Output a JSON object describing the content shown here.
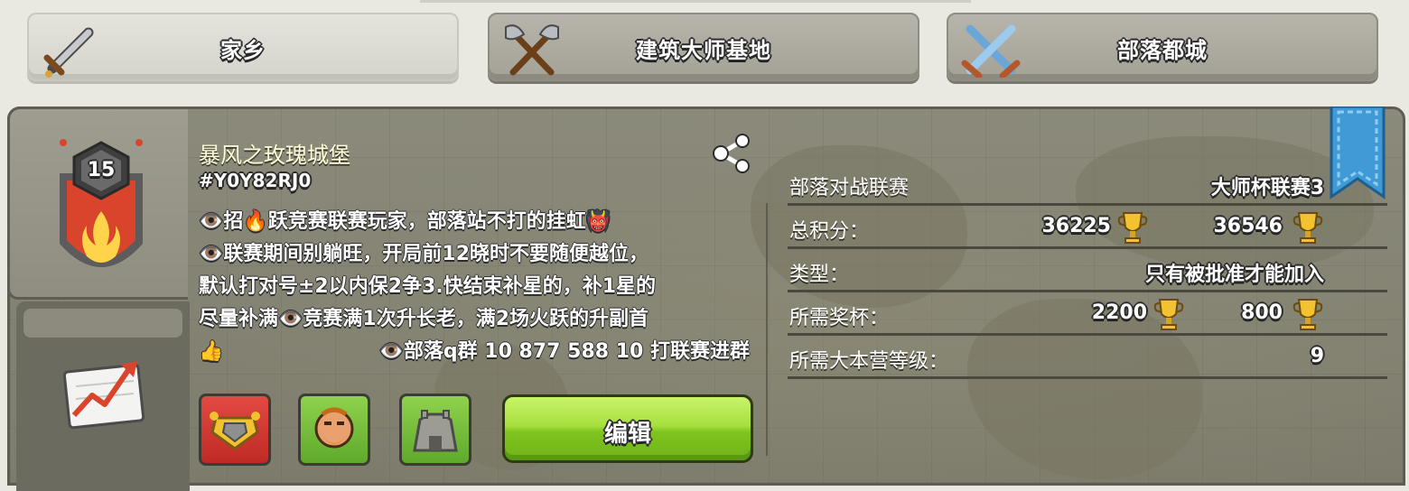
{
  "tabs": [
    {
      "label": "家乡",
      "icon": "sword-icon",
      "active": true
    },
    {
      "label": "建筑大师基地",
      "icon": "crossed-axes-icon",
      "active": false
    },
    {
      "label": "部落都城",
      "icon": "crossed-swords-icon",
      "active": false
    }
  ],
  "clan": {
    "level": "15",
    "name": "暴风之玫瑰城堡",
    "tag": "#Y0Y82RJ0",
    "description": [
      "👁️招🔥跃竞赛联赛玩家，部落站不打的挂虹👹",
      "👁️联赛期间别躺旺，开局前12晓时不要随便越位，",
      "默认打对号±2以内保2争3.快结束补星的，补1星的",
      "尽量补满👁️竞赛满1次升长老，满2场火跃的升副首",
      "👍",
      "👁️部落q群 10 877 588 10 打联赛进群"
    ],
    "edit_label": "编辑"
  },
  "info": {
    "league_label": "部落对战联赛",
    "league_value": "大师杯联赛3",
    "points_label": "总积分：",
    "points_home": "36225",
    "points_builder": "36546",
    "type_label": "类型：",
    "type_value": "只有被批准才能加入",
    "trophies_label": "所需奖杯：",
    "trophies_home": "2200",
    "trophies_builder": "800",
    "th_label": "所需大本营等级：",
    "th_value": "9"
  },
  "colors": {
    "badge_red": "#d8442c",
    "edit_green": "#8fd43a",
    "bookmark_blue": "#3f9ad6"
  }
}
